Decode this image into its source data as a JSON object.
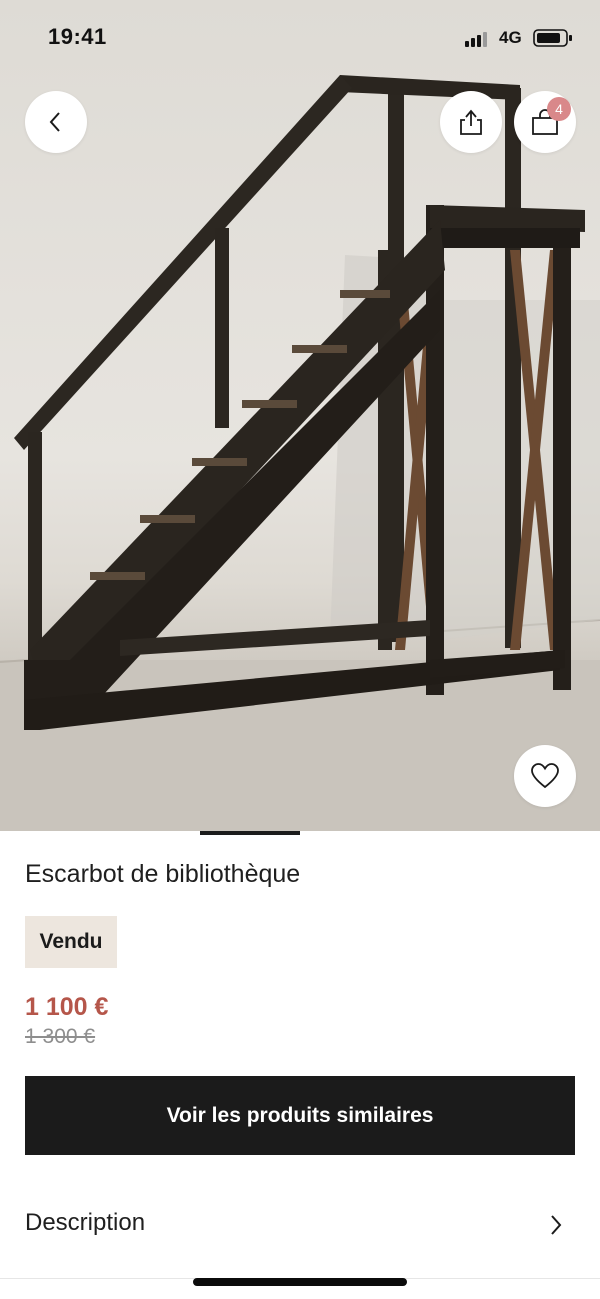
{
  "status_bar": {
    "time": "19:41",
    "network": "4G"
  },
  "header": {
    "back_icon": "chevron-left-icon",
    "share_icon": "share-icon",
    "cart_icon": "shopping-bag-icon",
    "cart_badge_count": "4"
  },
  "hero": {
    "favorite_icon": "heart-icon",
    "carousel_active_index": 1
  },
  "product": {
    "title": "Escarbot de bibliothèque",
    "status_badge": "Vendu",
    "price_current": "1 100 €",
    "price_original": "1 300 €"
  },
  "actions": {
    "similar_button_label": "Voir les produits similaires"
  },
  "description": {
    "label": "Description",
    "chevron_icon": "chevron-right-icon"
  },
  "colors": {
    "price_accent": "#b5564a",
    "badge_background": "#ede6de",
    "button_background": "#1b1b1b",
    "cart_badge": "#d9888a"
  }
}
